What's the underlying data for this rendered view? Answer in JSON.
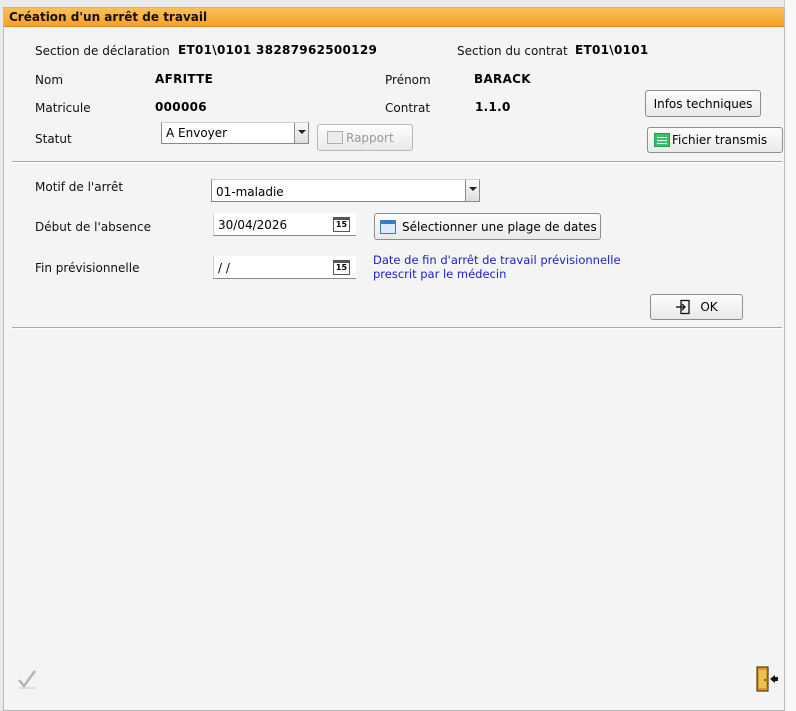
{
  "window": {
    "title": "Création d'un arrêt de travail"
  },
  "header": {
    "section_declaration_label": "Section de déclaration",
    "section_declaration_value": "ET01\\0101 38287962500129",
    "section_contrat_label": "Section du contrat",
    "section_contrat_value": "ET01\\0101",
    "nom_label": "Nom",
    "nom_value": "AFRITTE",
    "prenom_label": "Prénom",
    "prenom_value": "BARACK",
    "matricule_label": "Matricule",
    "matricule_value": "000006",
    "contrat_label": "Contrat",
    "contrat_value": "1.1.0",
    "statut_label": "Statut",
    "statut_value": "A Envoyer",
    "rapport_label": "Rapport",
    "infos_label": "Infos techniques",
    "fichier_label": "Fichier transmis"
  },
  "form": {
    "motif_label": "Motif de l'arrêt",
    "motif_value": "01-maladie",
    "debut_label": "Début de l'absence",
    "debut_value": "30/04/2026",
    "plage_label": "Sélectionner une plage de dates",
    "fin_label": "Fin prévisionnelle",
    "fin_value": " / /",
    "fin_hint_line1": "Date de fin d'arrêt de travail prévisionnelle",
    "fin_hint_line2": "prescrit par le médecin",
    "ok_label": "OK",
    "calendar_glyph": "15"
  },
  "footer": {
    "validate_icon": "checkmark-icon",
    "exit_icon": "exit-door-icon"
  }
}
